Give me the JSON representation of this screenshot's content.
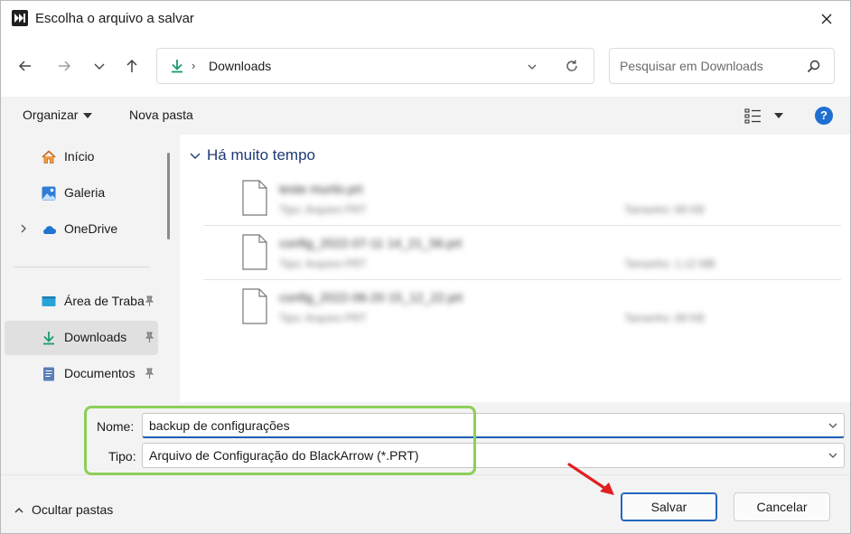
{
  "window": {
    "title": "Escolha o arquivo a salvar"
  },
  "nav": {
    "back_icon": "arrow-left",
    "forward_icon": "arrow-right",
    "history_icon": "chevron-down",
    "up_icon": "arrow-up",
    "address": "Downloads",
    "address_separator": "›",
    "search_placeholder": "Pesquisar em Downloads"
  },
  "commands": {
    "organize": "Organizar",
    "new_folder": "Nova pasta",
    "help": "?"
  },
  "sidebar": {
    "items": [
      {
        "label": "Início",
        "icon": "home"
      },
      {
        "label": "Galeria",
        "icon": "gallery"
      },
      {
        "label": "OneDrive",
        "icon": "cloud"
      },
      {
        "label": "Área de Traba",
        "icon": "desktop",
        "pinned": true
      },
      {
        "label": "Downloads",
        "icon": "download",
        "pinned": true,
        "selected": true
      },
      {
        "label": "Documentos",
        "icon": "document",
        "pinned": true
      }
    ]
  },
  "content": {
    "group_title": "Há muito tempo",
    "files": [
      {
        "name": "teste murilo.prt",
        "type": "Tipo: Arquivo PRT",
        "size": "Tamanho: 68 KB"
      },
      {
        "name": "config_2022-07-11 14_21_56.prt",
        "type": "Tipo: Arquivo PRT",
        "size": "Tamanho: 1,12 MB"
      },
      {
        "name": "config_2022-06-20 15_12_22.prt",
        "type": "Tipo: Arquivo PRT",
        "size": "Tamanho: 68 KB"
      }
    ]
  },
  "form": {
    "name_label": "Nome:",
    "name_value": "backup de configurações",
    "type_label": "Tipo:",
    "type_value": "Arquivo de Configuração do BlackArrow (*.PRT)"
  },
  "footer": {
    "hide_folders": "Ocultar pastas",
    "save": "Salvar",
    "cancel": "Cancelar"
  },
  "colors": {
    "accent": "#1a5fb4",
    "highlight": "#8ccf58",
    "annotation_arrow": "#e02020"
  }
}
